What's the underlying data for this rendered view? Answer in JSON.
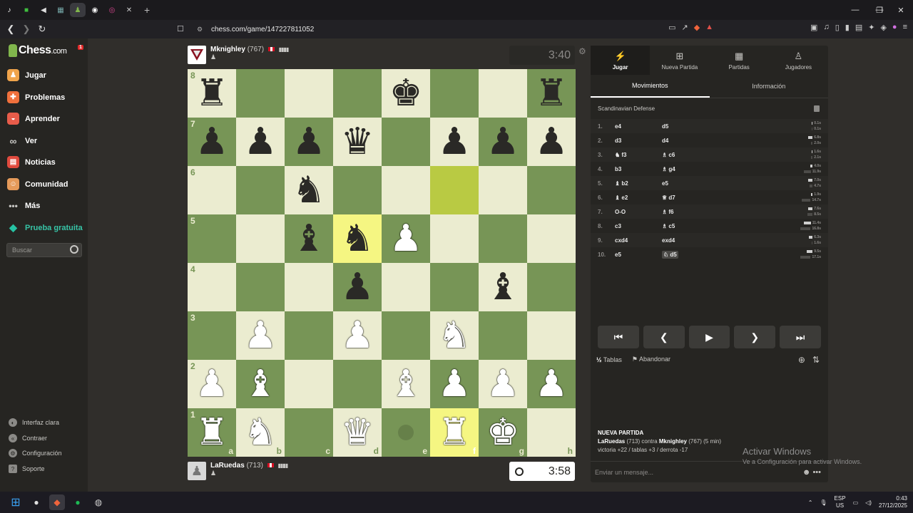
{
  "browser": {
    "url": "chess.com/game/147227811052",
    "tab_icons": [
      "tiktok-icon",
      "game-icon",
      "speaker-icon",
      "grid-icon",
      "chess-icon",
      "chrome-icon",
      "app-icon",
      "mute-icon"
    ],
    "new_tab": "+",
    "window_controls": [
      "—",
      "❐",
      "✕"
    ]
  },
  "sidebar": {
    "logo_main": "Chess",
    "logo_suffix": ".com",
    "notif_count": "1",
    "nav": [
      {
        "label": "Jugar",
        "icon": "play-icon",
        "color": "#f0a44b"
      },
      {
        "label": "Problemas",
        "icon": "puzzle-icon",
        "color": "#f0703c"
      },
      {
        "label": "Aprender",
        "icon": "learn-icon",
        "color": "#e85c4a"
      },
      {
        "label": "Ver",
        "icon": "binoculars-icon",
        "color": "#c9c8c5"
      },
      {
        "label": "Noticias",
        "icon": "news-icon",
        "color": "#e04a3e"
      },
      {
        "label": "Comunidad",
        "icon": "community-icon",
        "color": "#e59a5a"
      },
      {
        "label": "Más",
        "icon": "more-icon",
        "color": "#c9c8c5"
      },
      {
        "label": "Prueba gratuita",
        "icon": "diamond-icon",
        "color": "#26c2a3"
      }
    ],
    "search_placeholder": "Buscar",
    "bottom": [
      {
        "label": "Interfaz clara",
        "icon": "theme-icon"
      },
      {
        "label": "Contraer",
        "icon": "collapse-icon"
      },
      {
        "label": "Configuración",
        "icon": "settings-icon"
      },
      {
        "label": "Soporte",
        "icon": "help-icon"
      }
    ]
  },
  "top_player": {
    "name": "Mknighley",
    "rating": "(767)",
    "clock": "3:40"
  },
  "bottom_player": {
    "name": "LaRuedas",
    "rating": "(713)",
    "clock": "3:58"
  },
  "board": {
    "ranks": [
      "8",
      "7",
      "6",
      "5",
      "4",
      "3",
      "2",
      "1"
    ],
    "files": [
      "a",
      "b",
      "c",
      "d",
      "e",
      "f",
      "g",
      "h"
    ],
    "rows": [
      [
        "bR",
        "",
        "",
        "",
        "bK",
        "",
        "",
        "bR"
      ],
      [
        "bP",
        "bP",
        "bP",
        "bQ",
        "",
        "bP",
        "bP",
        "bP"
      ],
      [
        "",
        "",
        "bN",
        "",
        "",
        "",
        "",
        ""
      ],
      [
        "",
        "",
        "bB",
        "bN",
        "wP",
        "",
        "",
        ""
      ],
      [
        "",
        "",
        "",
        "bP",
        "",
        "",
        "bB",
        ""
      ],
      [
        "",
        "wP",
        "",
        "wP",
        "",
        "wN",
        "",
        ""
      ],
      [
        "wP",
        "wB",
        "",
        "",
        "wB",
        "wP",
        "wP",
        "wP"
      ],
      [
        "wR",
        "wN",
        "",
        "wQ",
        "",
        "wR",
        "wK",
        ""
      ]
    ],
    "highlights": [
      "f6",
      "d5",
      "f1"
    ],
    "move_dot": "e1"
  },
  "panel": {
    "tabs": [
      {
        "label": "Jugar",
        "icon": "bolt-icon"
      },
      {
        "label": "Nueva Partida",
        "icon": "plus-icon"
      },
      {
        "label": "Partidas",
        "icon": "board-icon"
      },
      {
        "label": "Jugadores",
        "icon": "players-icon"
      }
    ],
    "subtabs": [
      "Movimientos",
      "Información"
    ],
    "opening": "Scandinavian Defense",
    "moves": [
      {
        "n": "1.",
        "w": "e4",
        "b": "d5",
        "tw": "0.1s",
        "tb": "0.1s",
        "fw": 0.02,
        "fb": 0.02
      },
      {
        "n": "2.",
        "w": "d3",
        "b": "d4",
        "tw": "6.8s",
        "tb": "2.0s",
        "fw": 0.4,
        "fb": 0.12
      },
      {
        "n": "3.",
        "w": "♞ f3",
        "b": "♗ c6",
        "tw": "1.6s",
        "tb": "2.1s",
        "fw": 0.1,
        "fb": 0.13
      },
      {
        "n": "4.",
        "w": "b3",
        "b": "♗ g4",
        "tw": "4.0s",
        "tb": "11.9s",
        "fw": 0.24,
        "fb": 0.7
      },
      {
        "n": "5.",
        "w": "♝ b2",
        "b": "e5",
        "tw": "7.0s",
        "tb": "4.7s",
        "fw": 0.42,
        "fb": 0.28
      },
      {
        "n": "6.",
        "w": "♝ e2",
        "b": "♕ d7",
        "tw": "1.9s",
        "tb": "14.7s",
        "fw": 0.12,
        "fb": 0.88
      },
      {
        "n": "7.",
        "w": "O-O",
        "b": "♗ f6",
        "tw": "7.6s",
        "tb": "8.5s",
        "fw": 0.45,
        "fb": 0.5
      },
      {
        "n": "8.",
        "w": "c3",
        "b": "♗ c5",
        "tw": "11.4s",
        "tb": "16.8s",
        "fw": 0.68,
        "fb": 1.0
      },
      {
        "n": "9.",
        "w": "cxd4",
        "b": "exd4",
        "tw": "6.3s",
        "tb": "1.6s",
        "fw": 0.38,
        "fb": 0.1
      },
      {
        "n": "10.",
        "w": "e5",
        "b": "♘ d5",
        "tw": "9.5s",
        "tb": "17.1s",
        "fw": 0.57,
        "fb": 1.0
      }
    ],
    "controls": [
      "⏮",
      "❮",
      "▶",
      "❯",
      "⏭"
    ],
    "draw_icon": "½",
    "draw_label": "Tablas",
    "resign_label": "Abandonar",
    "new_game_title": "NUEVA PARTIDA",
    "new_game_p1": "LaRuedas",
    "new_game_p1_rating": "(713)",
    "new_game_vs": "contra",
    "new_game_p2": "Mknighley",
    "new_game_p2_rating": "(767)",
    "new_game_time": "(5 min)",
    "new_game_stats": "victoria +22 / tablas +3 / derrota -17",
    "chat_placeholder": "Enviar un mensaje..."
  },
  "watermark": {
    "line1": "Activar Windows",
    "line2": "Ve a Configuración para activar Windows."
  },
  "taskbar": {
    "lang1": "ESP",
    "lang2": "US",
    "time": "0:43",
    "date": "27/12/2025"
  }
}
